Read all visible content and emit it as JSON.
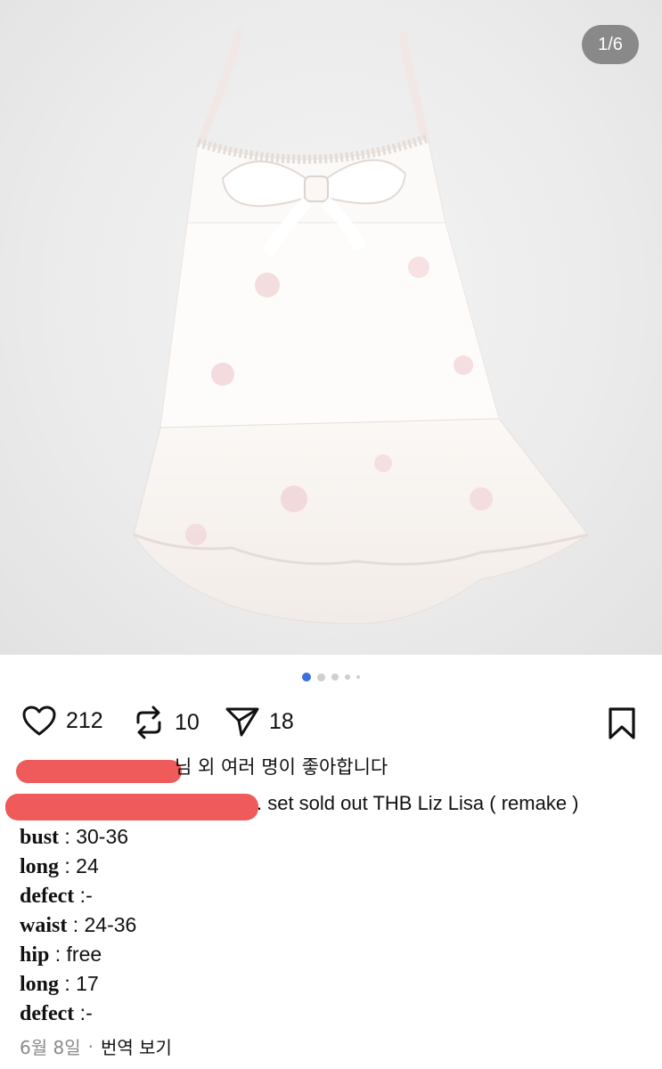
{
  "photo": {
    "counter": "1/6",
    "dot_count": 5,
    "active_dot": 0
  },
  "actions": {
    "likes": "212",
    "reposts": "10",
    "shares": "18"
  },
  "likes_line": "님 외 여러 명이 좋아합니다",
  "caption": ". set sold out THB Liz Lisa ( remake )",
  "specs": [
    {
      "label": "bust",
      "value": " : 30-36"
    },
    {
      "label": "long",
      "value": " : 24"
    },
    {
      "label": "defect",
      "value": " :-"
    },
    {
      "label": "waist",
      "value": " : 24-36"
    },
    {
      "label": "hip",
      "value": " : free"
    },
    {
      "label": "long",
      "value": " : 17"
    },
    {
      "label": "defect",
      "value": " :-"
    }
  ],
  "meta": {
    "date": "6월 8일",
    "separator": "·",
    "translate": "번역 보기"
  },
  "colors": {
    "accent_dot": "#3b6fe0",
    "redaction": "#ee4d4d"
  }
}
